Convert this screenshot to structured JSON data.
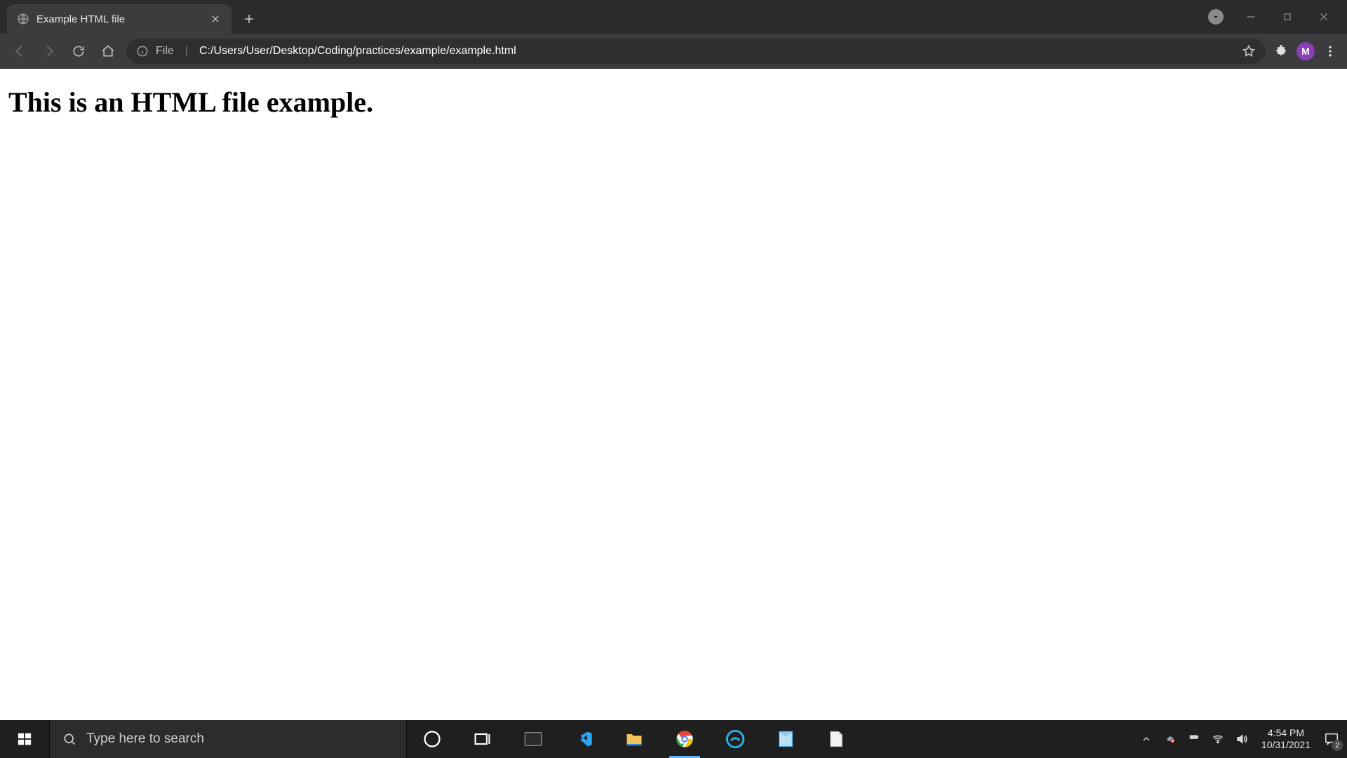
{
  "browser": {
    "tab_title": "Example HTML file",
    "url_scheme": "File",
    "url_path": "C:/Users/User/Desktop/Coding/practices/example/example.html",
    "profile_initial": "M"
  },
  "page": {
    "heading": "This is an HTML file example."
  },
  "taskbar": {
    "search_placeholder": "Type here to search",
    "clock_time": "4:54 PM",
    "clock_date": "10/31/2021",
    "action_center_count": "2"
  }
}
